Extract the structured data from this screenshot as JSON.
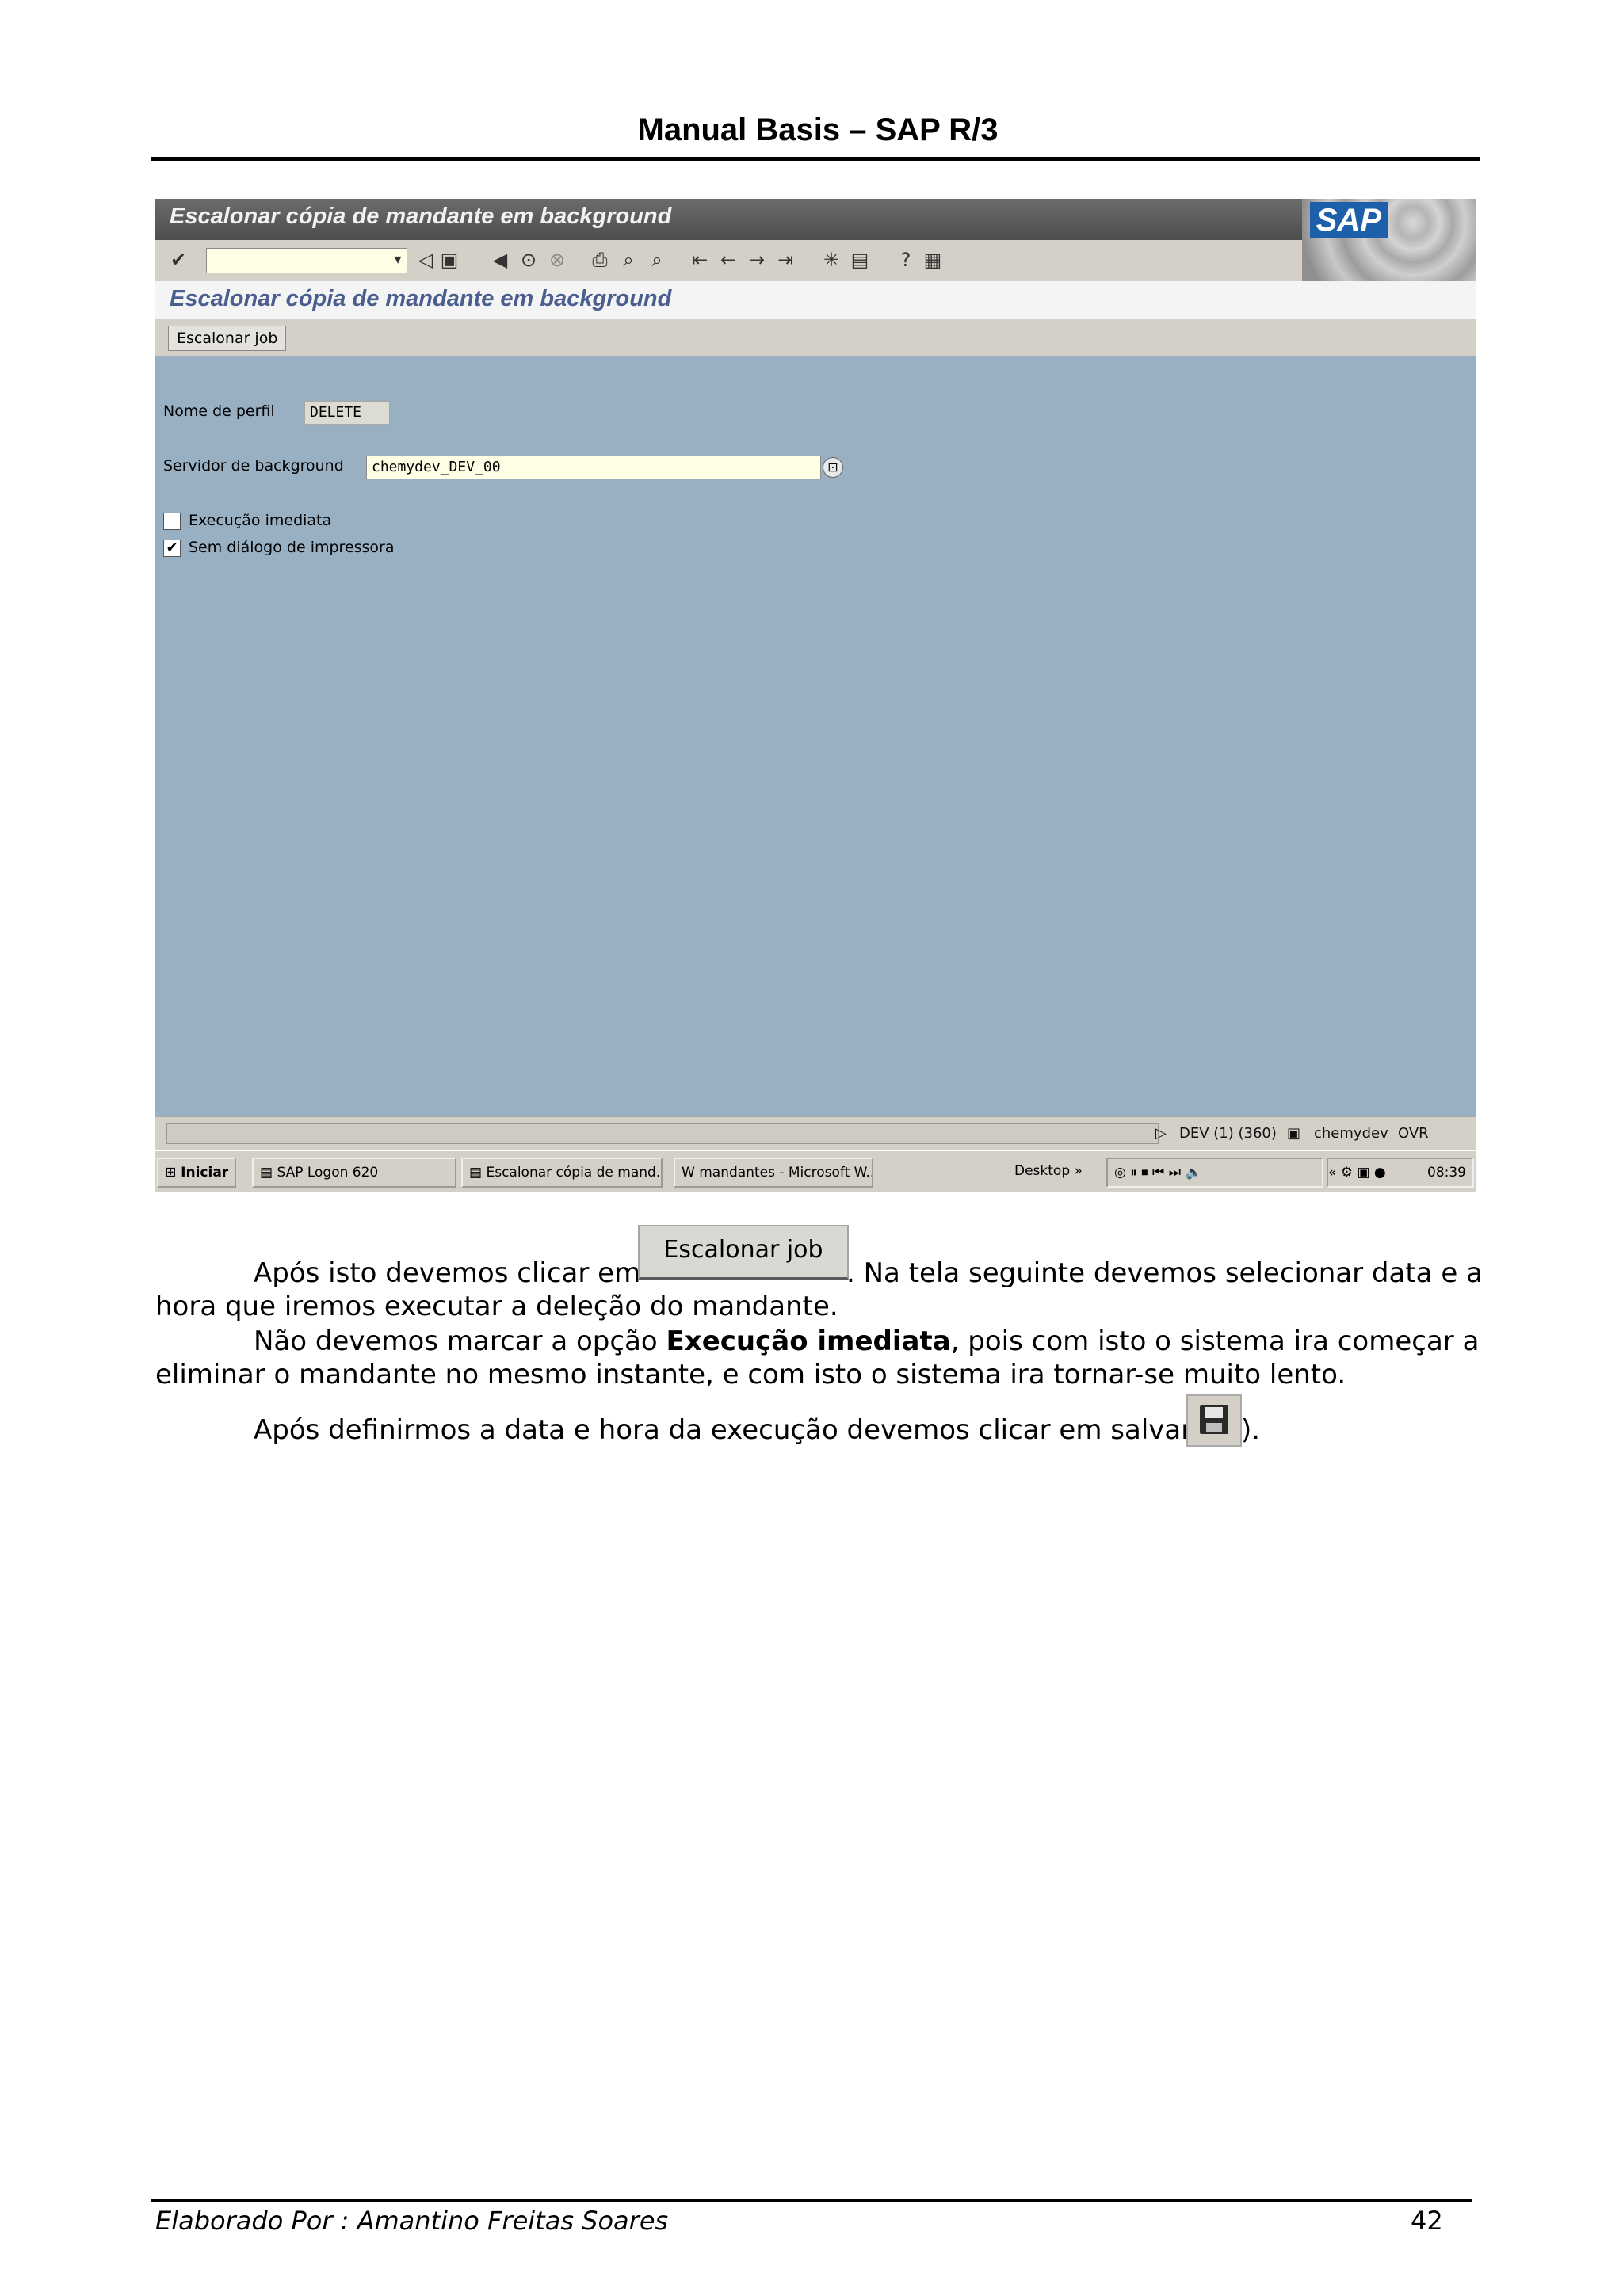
{
  "document": {
    "header": "Manual Basis – SAP R/3",
    "footer_author": "Elaborado Por : Amantino Freitas Soares",
    "page_number": "42"
  },
  "sap": {
    "window_title": "Escalonar cópia de mandante em background",
    "logo": "SAP",
    "subtitle": "Escalonar cópia de mandante em background",
    "app_button": "Escalonar job",
    "profile_label": "Nome de perfil",
    "profile_value": "DELETE",
    "server_label": "Servidor de background",
    "server_value": "chemydev_DEV_00",
    "checkbox_immediate": "Execução imediata",
    "checkbox_no_dialog": "Sem diálogo de impressora",
    "status_system": "DEV (1) (360)",
    "status_server": "chemydev",
    "status_mode": "OVR"
  },
  "taskbar": {
    "start": "Iniciar",
    "logon": "SAP Logon 620",
    "escalonar": "Escalonar cópia de mand...",
    "word": "mandantes - Microsoft W...",
    "desktop": "Desktop",
    "time": "08:39"
  },
  "body": {
    "p1_prefix": "Após isto devemos clicar em",
    "inline_button": "Escalonar job",
    "p1_suffix": ". Na tela seguinte devemos selecionar data e a",
    "p1_line2": "hora que iremos executar a deleção do mandante.",
    "p2_prefix": "Não devemos marcar a opção",
    "p2_bold": "Execução imediata",
    "p2_suffix": ", pois com isto o sistema ira começar a",
    "p2_line2": "eliminar o mandante no mesmo instante, e com isto o sistema ira tornar-se muito lento.",
    "p3_prefix": "Após definirmos a data e hora da execução devemos clicar em salvar (",
    "p3_suffix": ")."
  }
}
